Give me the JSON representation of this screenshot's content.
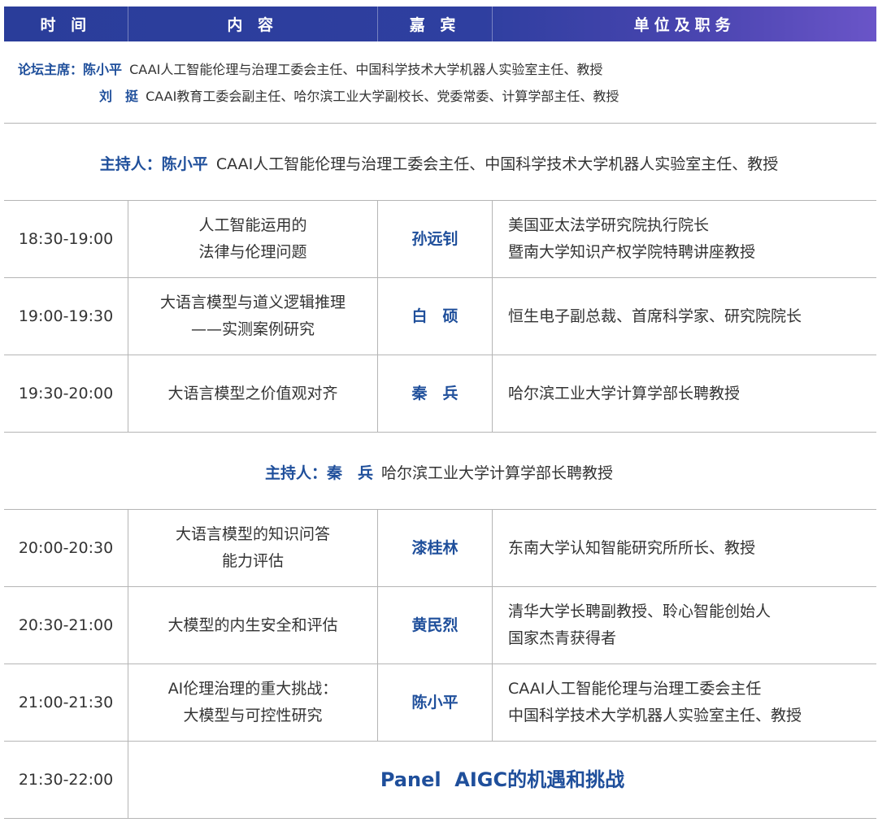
{
  "header": {
    "col_time": "时 间",
    "col_content": "内 容",
    "col_guest": "嘉 宾",
    "col_org": "单位及职务"
  },
  "chairs": {
    "label": "论坛主席：",
    "chair1_name": "陈小平",
    "chair1_title": "CAAI人工智能伦理与治理工委会主任、中国科学技术大学机器人实验室主任、教授",
    "chair2_name": "刘　挺",
    "chair2_title": "CAAI教育工委会副主任、哈尔滨工业大学副校长、党委常委、计算学部主任、教授"
  },
  "session1": {
    "host_label": "主持人：",
    "host_name": "陈小平",
    "host_title": "CAAI人工智能伦理与治理工委会主任、中国科学技术大学机器人实验室主任、教授"
  },
  "session2": {
    "host_label": "主持人：",
    "host_name": "秦　兵",
    "host_title": "哈尔滨工业大学计算学部长聘教授"
  },
  "rows": [
    {
      "time": "18:30-19:00",
      "content": [
        "人工智能运用的",
        "法律与伦理问题"
      ],
      "guest": "孙远钊",
      "org": [
        "美国亚太法学研究院执行院长",
        "暨南大学知识产权学院特聘讲座教授"
      ]
    },
    {
      "time": "19:00-19:30",
      "content": [
        "大语言模型与道义逻辑推理",
        "——实测案例研究"
      ],
      "guest": "白　硕",
      "org": [
        "恒生电子副总裁、首席科学家、研究院院长"
      ]
    },
    {
      "time": "19:30-20:00",
      "content": [
        "大语言模型之价值观对齐"
      ],
      "guest": "秦　兵",
      "org": [
        "哈尔滨工业大学计算学部长聘教授"
      ]
    },
    {
      "time": "20:00-20:30",
      "content": [
        "大语言模型的知识问答",
        "能力评估"
      ],
      "guest": "漆桂林",
      "org": [
        "东南大学认知智能研究所所长、教授"
      ]
    },
    {
      "time": "20:30-21:00",
      "content": [
        "大模型的内生安全和评估"
      ],
      "guest": "黄民烈",
      "org": [
        "清华大学长聘副教授、聆心智能创始人",
        "国家杰青获得者"
      ]
    },
    {
      "time": "21:00-21:30",
      "content": [
        "AI伦理治理的重大挑战：",
        "大模型与可控性研究"
      ],
      "guest": "陈小平",
      "org": [
        "CAAI人工智能伦理与治理工委会主任",
        "中国科学技术大学机器人实验室主任、教授"
      ]
    }
  ],
  "panel": {
    "time": "21:30-22:00",
    "title": "Panel  AIGC的机遇和挑战"
  },
  "colors": {
    "header_gradient_start": "#2a3d9a",
    "header_gradient_end": "#6a55c8",
    "accent_blue": "#1f4f9b",
    "text": "#333333",
    "rule": "#b5b5b5"
  }
}
